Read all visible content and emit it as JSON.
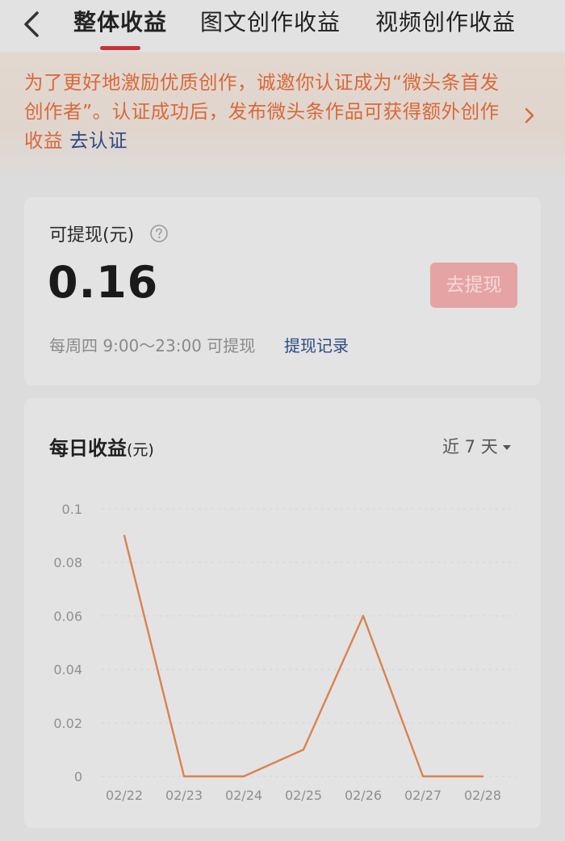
{
  "header": {
    "tabs": [
      {
        "label": "整体收益",
        "active": true
      },
      {
        "label": "图文创作收益",
        "active": false
      },
      {
        "label": "视频创作收益",
        "active": false
      }
    ],
    "accent_color": "#c9323c"
  },
  "banner": {
    "text": "为了更好地激励优质创作，诚邀你认证成为“微头条首发创作者”。认证成功后，发布微头条作品可获得额外创作收益",
    "link": "去认证",
    "text_color": "#d9683a"
  },
  "balance": {
    "label": "可提现(元)",
    "value": "0.16",
    "withdraw_button": "去提现",
    "schedule": "每周四 9:00～23:00 可提现",
    "records_link": "提现记录"
  },
  "daily": {
    "title": "每日收益",
    "unit": "(元)",
    "range_label": "近 7 天"
  },
  "chart_data": {
    "type": "line",
    "categories": [
      "02/22",
      "02/23",
      "02/24",
      "02/25",
      "02/26",
      "02/27",
      "02/28"
    ],
    "values": [
      0.09,
      0,
      0,
      0.01,
      0.06,
      0,
      0
    ],
    "ylim": [
      0,
      0.1
    ],
    "y_ticks": [
      "0",
      "0.02",
      "0.04",
      "0.06",
      "0.08",
      "0.1"
    ],
    "grid": true,
    "line_color": "#d9834e"
  },
  "icons": {
    "back": "chevron-left",
    "help": "question-circle",
    "banner_arrow": "chevron-right",
    "range_caret": "caret-down"
  }
}
